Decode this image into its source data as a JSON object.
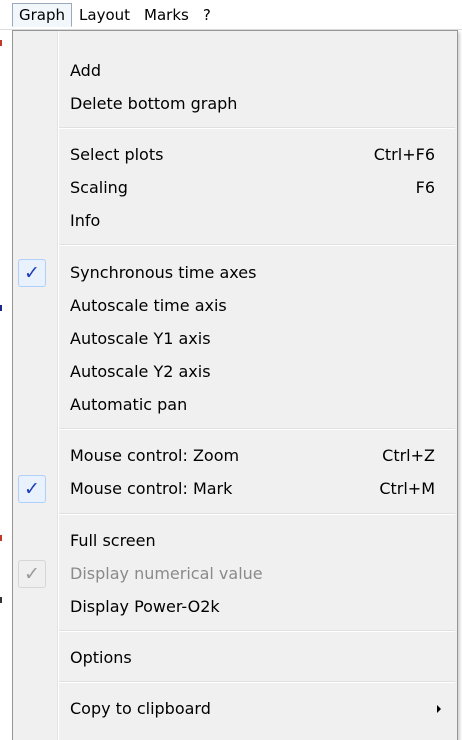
{
  "menubar": {
    "items": [
      {
        "label": "Graph",
        "open": true
      },
      {
        "label": "Layout"
      },
      {
        "label": "Marks"
      },
      {
        "label": "?"
      }
    ]
  },
  "dropdown": {
    "items": [
      {
        "label": "Add"
      },
      {
        "label": "Delete bottom graph"
      },
      {
        "label": "Select plots",
        "shortcut": "Ctrl+F6"
      },
      {
        "label": "Scaling",
        "shortcut": "F6"
      },
      {
        "label": "Info"
      },
      {
        "label": "Synchronous time axes",
        "checked": true
      },
      {
        "label": "Autoscale time axis"
      },
      {
        "label": "Autoscale Y1 axis"
      },
      {
        "label": "Autoscale Y2 axis"
      },
      {
        "label": "Automatic pan"
      },
      {
        "label": "Mouse control: Zoom",
        "shortcut": "Ctrl+Z"
      },
      {
        "label": "Mouse control: Mark",
        "shortcut": "Ctrl+M",
        "checked": true
      },
      {
        "label": "Full screen"
      },
      {
        "label": "Display numerical value",
        "checked": true,
        "disabled": true
      },
      {
        "label": "Display Power-O2k"
      },
      {
        "label": "Options"
      },
      {
        "label": "Copy to clipboard",
        "submenu": true
      }
    ]
  },
  "icons": {
    "check": "checkmark-icon",
    "submenu": "submenu-arrow-icon"
  },
  "colors": {
    "menu_background": "#f0f0f0",
    "check_highlight": "#e8f1fc",
    "check_mark": "#1f3fb8",
    "disabled_text": "#8a8a8a"
  }
}
